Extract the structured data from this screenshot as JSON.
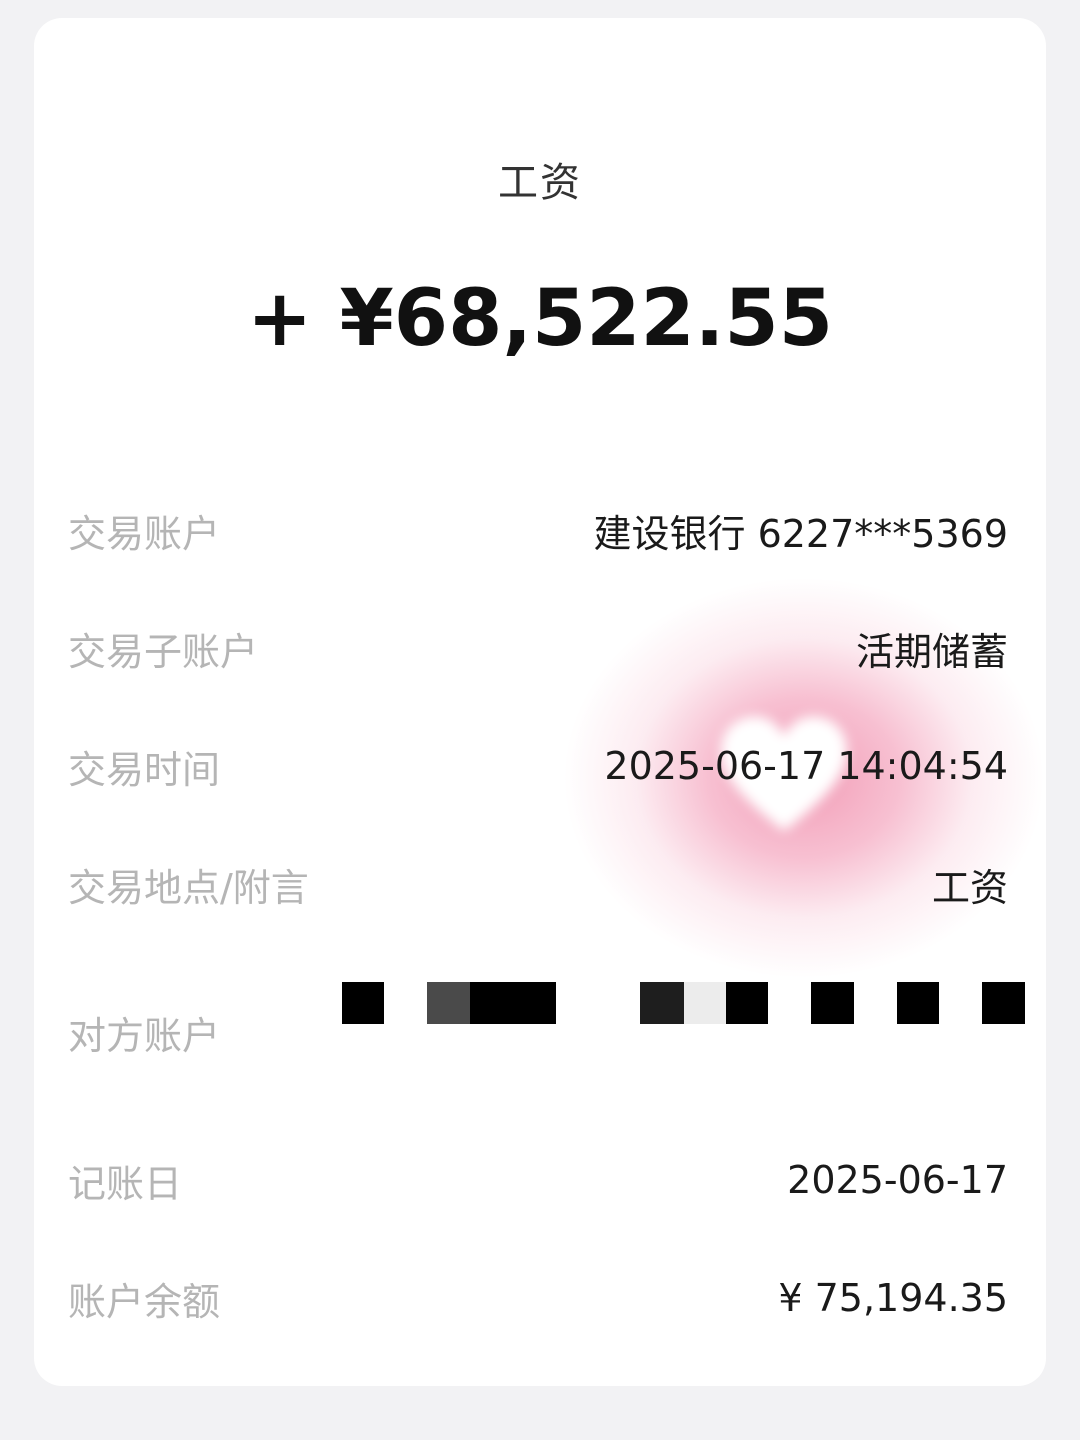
{
  "transaction": {
    "title": "工资",
    "amount": "+ ¥68,522.55"
  },
  "details": {
    "account_label": "交易账户",
    "account_value": "建设银行 6227***5369",
    "sub_account_label": "交易子账户",
    "sub_account_value": "活期储蓄",
    "time_label": "交易时间",
    "time_value": "2025-06-17 14:04:54",
    "note_label": "交易地点/附言",
    "note_value": "工资",
    "counterparty_label": "对方账户",
    "booking_date_label": "记账日",
    "booking_date_value": "2025-06-17",
    "balance_label": "账户余额",
    "balance_value": "¥ 75,194.35"
  },
  "decorations": {
    "glow_color": "#f4a5be",
    "heart_color": "#ffffff",
    "redaction_color": "#000000"
  }
}
